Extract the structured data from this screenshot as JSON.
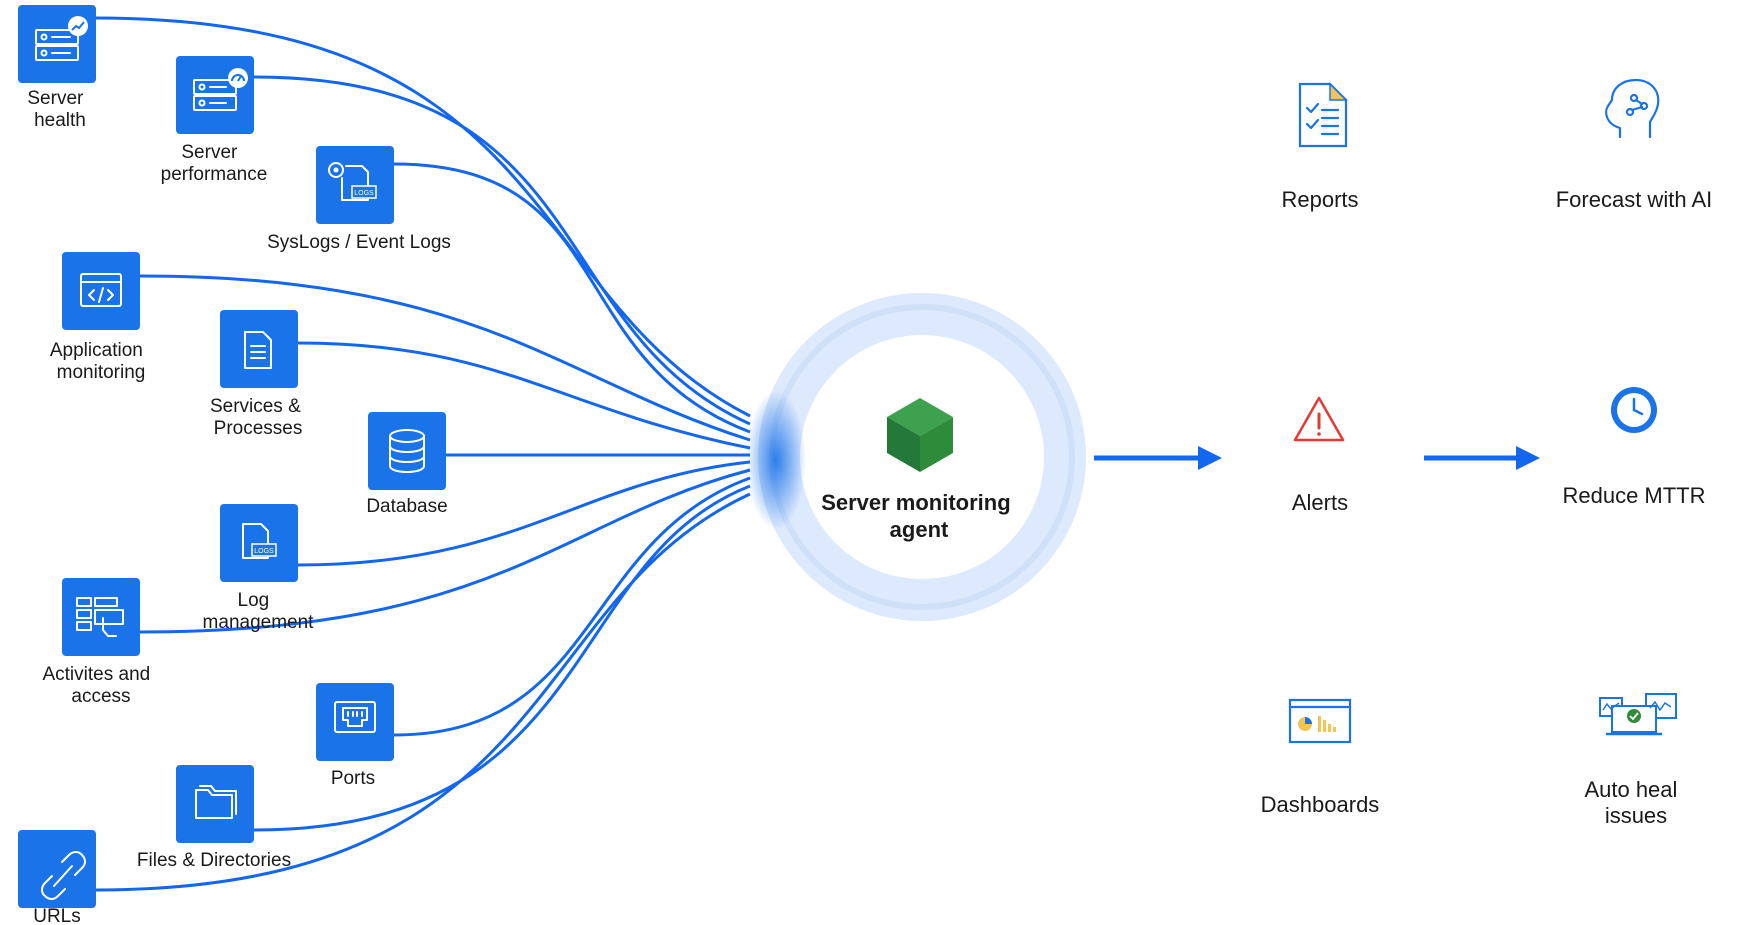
{
  "colors": {
    "accent": "#1366f0",
    "tile": "#1a73e8",
    "agent_ring": "#dbe8fb",
    "cube": "#2e8b3a",
    "alert": "#e53935",
    "doc_fold": "#f6c453"
  },
  "sources": [
    {
      "id": "server-health",
      "lines": [
        "Server",
        "health"
      ],
      "icon": "server-health-icon"
    },
    {
      "id": "server-performance",
      "lines": [
        "Server",
        "performance"
      ],
      "icon": "server-performance-icon"
    },
    {
      "id": "syslogs",
      "lines": [
        "SysLogs / Event Logs"
      ],
      "icon": "syslogs-icon"
    },
    {
      "id": "application-monitoring",
      "lines": [
        "Application",
        "monitoring"
      ],
      "icon": "code-window-icon"
    },
    {
      "id": "services-processes",
      "lines": [
        "Services &",
        "Processes"
      ],
      "icon": "document-icon"
    },
    {
      "id": "database",
      "lines": [
        "Database"
      ],
      "icon": "database-icon"
    },
    {
      "id": "log-management",
      "lines": [
        "Log",
        "management"
      ],
      "icon": "logs-icon"
    },
    {
      "id": "activities-access",
      "lines": [
        "Activites and",
        "access"
      ],
      "icon": "access-icon"
    },
    {
      "id": "ports",
      "lines": [
        "Ports"
      ],
      "icon": "port-icon"
    },
    {
      "id": "files-directories",
      "lines": [
        "Files & Directories"
      ],
      "icon": "folder-icon"
    },
    {
      "id": "urls",
      "lines": [
        "URLs"
      ],
      "icon": "link-icon"
    }
  ],
  "agent": {
    "lines": [
      "Server monitoring",
      "agent"
    ],
    "icon": "cube-icon"
  },
  "outputs": [
    {
      "id": "reports",
      "lines": [
        "Reports"
      ],
      "icon": "report-icon"
    },
    {
      "id": "forecast-ai",
      "lines": [
        "Forecast with AI"
      ],
      "icon": "ai-head-icon"
    },
    {
      "id": "alerts",
      "lines": [
        "Alerts"
      ],
      "icon": "alert-icon"
    },
    {
      "id": "reduce-mttr",
      "lines": [
        "Reduce MTTR"
      ],
      "icon": "clock-icon"
    },
    {
      "id": "dashboards",
      "lines": [
        "Dashboards"
      ],
      "icon": "dashboard-icon"
    },
    {
      "id": "auto-heal",
      "lines": [
        "Auto heal",
        "issues"
      ],
      "icon": "auto-heal-icon"
    }
  ]
}
